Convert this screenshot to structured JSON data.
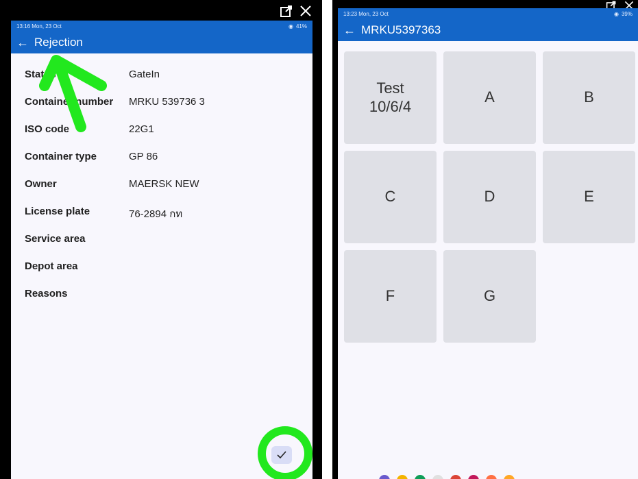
{
  "left_screen": {
    "status_time": "13:16",
    "status_date": "Mon, 23 Oct",
    "status_right": "41%",
    "title": "Rejection",
    "rows": [
      {
        "label": "Status",
        "value": "GateIn"
      },
      {
        "label": "Container number",
        "value": "MRKU 539736 3"
      },
      {
        "label": "ISO code",
        "value": "22G1"
      },
      {
        "label": "Container type",
        "value": "GP 86"
      },
      {
        "label": "Owner",
        "value": "MAERSK NEW"
      },
      {
        "label": "License plate",
        "value": "76-2894 กท"
      },
      {
        "label": "Service area",
        "value": ""
      },
      {
        "label": "Depot area",
        "value": ""
      },
      {
        "label": "Reasons",
        "value": ""
      }
    ],
    "check_icon": "check-icon",
    "annotation_color": "#22e81e"
  },
  "right_screen": {
    "status_time": "13:23",
    "status_date": "Mon, 23 Oct",
    "status_right": "39%",
    "title": "MRKU5397363",
    "tiles": [
      "Test\n10/6/4",
      "A",
      "B",
      "C",
      "D",
      "E",
      "F",
      "G"
    ]
  },
  "colors": {
    "app_bar": "#1466c8",
    "tile_bg": "#dfe0e6",
    "screen_bg": "#f8f7fd"
  }
}
